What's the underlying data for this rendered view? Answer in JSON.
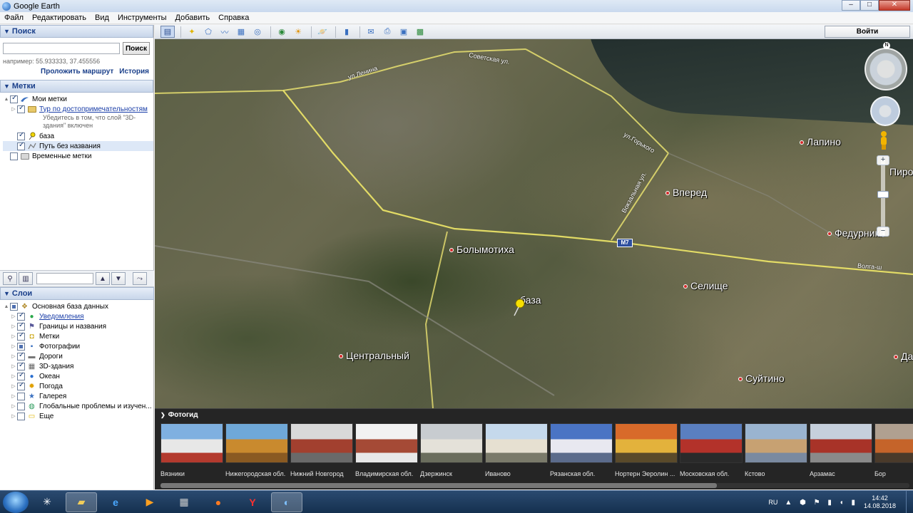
{
  "window": {
    "title": "Google Earth",
    "minimize": "–",
    "maximize": "□",
    "close": "✕"
  },
  "menu": [
    "Файл",
    "Редактировать",
    "Вид",
    "Инструменты",
    "Добавить",
    "Справка"
  ],
  "search_panel": {
    "header": "Поиск",
    "input_value": "",
    "button": "Поиск",
    "hint": "например: 55.933333, 37.455556",
    "route_link": "Проложить маршрут",
    "history_link": "История"
  },
  "places_panel": {
    "header": "Метки",
    "items": [
      {
        "label": "Мои метки",
        "checked": "partial",
        "level": 0
      },
      {
        "label": "Тур по достопримечательностям",
        "checked": "checked",
        "level": 1,
        "link": true,
        "note": "Убедитесь в том, что слой \"3D-здания\" включен"
      },
      {
        "label": "база",
        "checked": "checked",
        "level": 1
      },
      {
        "label": "Путь без названия",
        "checked": "checked",
        "level": 1
      },
      {
        "label": "Временные метки",
        "checked": "unchecked",
        "level": 0
      }
    ]
  },
  "layers_panel": {
    "header": "Слои",
    "items": [
      {
        "label": "Основная база данных",
        "checked": "partial",
        "level": 0,
        "icon": "database-icon"
      },
      {
        "label": "Уведомления",
        "checked": "checked",
        "level": 1,
        "link": true,
        "icon": "info-icon"
      },
      {
        "label": "Границы и названия",
        "checked": "checked",
        "level": 1,
        "icon": "borders-icon"
      },
      {
        "label": "Метки",
        "checked": "checked",
        "level": 1,
        "icon": "placemark-icon"
      },
      {
        "label": "Фотографии",
        "checked": "partial",
        "level": 1,
        "icon": "photo-icon"
      },
      {
        "label": "Дороги",
        "checked": "checked",
        "level": 1,
        "icon": "road-icon"
      },
      {
        "label": "3D-здания",
        "checked": "checked",
        "level": 1,
        "icon": "building-icon"
      },
      {
        "label": "Океан",
        "checked": "checked",
        "level": 1,
        "icon": "ocean-icon"
      },
      {
        "label": "Погода",
        "checked": "checked",
        "level": 1,
        "icon": "weather-icon"
      },
      {
        "label": "Галерея",
        "checked": "unchecked",
        "level": 1,
        "icon": "gallery-icon"
      },
      {
        "label": "Глобальные проблемы и изучен...",
        "checked": "unchecked",
        "level": 1,
        "icon": "globe-icon"
      },
      {
        "label": "Еще",
        "checked": "unchecked",
        "level": 1,
        "icon": "more-icon"
      }
    ]
  },
  "toolbar": {
    "login_button": "Войти"
  },
  "map": {
    "places": [
      {
        "name": "Лапино"
      },
      {
        "name": "Вперед"
      },
      {
        "name": "Федурнико"
      },
      {
        "name": "Болымотиха"
      },
      {
        "name": "база"
      },
      {
        "name": "Селище"
      },
      {
        "name": "Центральный"
      },
      {
        "name": "Суйтино"
      },
      {
        "name": "Пиро"
      },
      {
        "name": "Да"
      }
    ],
    "roads": [
      "ул.Ленина",
      "Советская ул.",
      "ул.Горького",
      "Вокзальная ул.",
      "Волга-ш"
    ],
    "highway_shield": "M7",
    "compass_north": "N"
  },
  "photo_guide": {
    "header": "Фотогид",
    "photos": [
      {
        "caption": "Вязники",
        "colors": [
          "#7fb0e0",
          "#e7e7e7",
          "#b33a2e"
        ]
      },
      {
        "caption": "Нижегородская обл.",
        "colors": [
          "#6fa8d8",
          "#c98a2e",
          "#8a5a22"
        ]
      },
      {
        "caption": "Нижний Новгород",
        "colors": [
          "#d9d9d9",
          "#a2402f",
          "#6a6a6a"
        ]
      },
      {
        "caption": "Владимирская обл.",
        "colors": [
          "#f2f2f2",
          "#a54a36",
          "#e8e8e8"
        ]
      },
      {
        "caption": "Дзержинск",
        "colors": [
          "#c8ccd0",
          "#e4e1d9",
          "#6a6d5d"
        ]
      },
      {
        "caption": "Иваново",
        "colors": [
          "#c5d9ec",
          "#e6e0d1",
          "#7a7a6a"
        ]
      },
      {
        "caption": "Рязанская обл.",
        "colors": [
          "#4a74c4",
          "#e8e8f0",
          "#5b6b8b"
        ]
      },
      {
        "caption": "Нортерн Эеролин ...",
        "colors": [
          "#d86a2a",
          "#e3b23c",
          "#5a4a2a"
        ]
      },
      {
        "caption": "Московская обл.",
        "colors": [
          "#5a7fc0",
          "#b3322a",
          "#2a2a2a"
        ]
      },
      {
        "caption": "Кстово",
        "colors": [
          "#9ab4d0",
          "#c7a172",
          "#7a8aa0"
        ]
      },
      {
        "caption": "Арзамас",
        "colors": [
          "#c6d0dc",
          "#a83328",
          "#8a8a8a"
        ]
      },
      {
        "caption": "Бор",
        "colors": [
          "#b0a090",
          "#c5642a",
          "#4a3a2a"
        ]
      }
    ]
  },
  "taskbar": {
    "lang": "RU",
    "time": "14:42",
    "date": "14.08.2018"
  }
}
